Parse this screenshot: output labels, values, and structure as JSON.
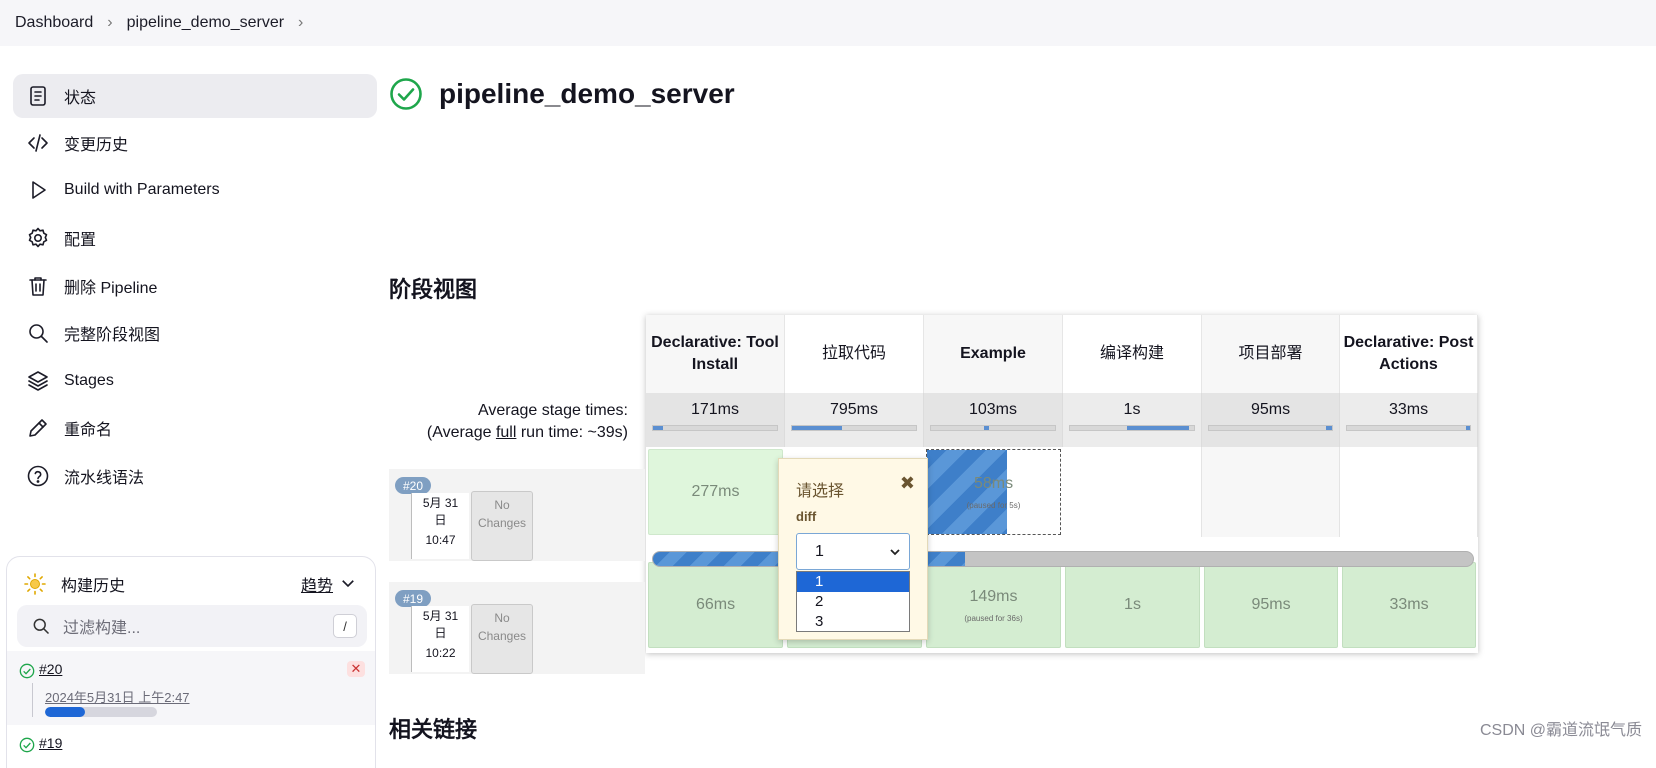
{
  "breadcrumb": {
    "items": [
      "Dashboard",
      "pipeline_demo_server"
    ],
    "separator": ">"
  },
  "sidebar": {
    "items": [
      {
        "label": "状态",
        "icon": "document-icon",
        "active": true
      },
      {
        "label": "变更历史",
        "icon": "code-icon"
      },
      {
        "label": "Build with Parameters",
        "icon": "play-icon"
      },
      {
        "label": "配置",
        "icon": "gear-icon"
      },
      {
        "label": "删除 Pipeline",
        "icon": "trash-icon"
      },
      {
        "label": "完整阶段视图",
        "icon": "search-icon"
      },
      {
        "label": "Stages",
        "icon": "layers-icon"
      },
      {
        "label": "重命名",
        "icon": "pencil-icon"
      },
      {
        "label": "流水线语法",
        "icon": "help-icon"
      }
    ]
  },
  "build_history": {
    "title": "构建历史",
    "trend_label": "趋势",
    "filter_placeholder": "过滤构建...",
    "filter_shortcut": "/",
    "builds": [
      {
        "number": "#20",
        "date": "2024年5月31日 上午2:47",
        "progress": 0.36,
        "status": "success"
      },
      {
        "number": "#19",
        "status": "success"
      }
    ]
  },
  "main": {
    "title": "pipeline_demo_server",
    "stage_view_title": "阶段视图",
    "related_links_title": "相关链接"
  },
  "stage_view": {
    "stages": [
      "Declarative: Tool Install",
      "拉取代码",
      "Example",
      "编译构建",
      "项目部署",
      "Declarative: Post Actions"
    ],
    "avg_times": [
      "171ms",
      "795ms",
      "103ms",
      "1s",
      "95ms",
      "33ms"
    ],
    "avg_label_line1": "Average stage times:",
    "avg_label_prefix": "(Average ",
    "avg_label_link": "full",
    "avg_label_suffix": " run time: ~39s)",
    "runs": [
      {
        "badge": "#20",
        "month_day": "5月 31",
        "day_unit": "日",
        "time": "10:47",
        "changes": "No Changes",
        "cells": [
          {
            "text": "277ms"
          },
          {
            "text": ""
          },
          {
            "text": "58ms",
            "note": "(paused for 5s)"
          },
          {
            "text": ""
          },
          {
            "text": ""
          },
          {
            "text": ""
          }
        ],
        "run_progress": 0.38
      },
      {
        "badge": "#19",
        "month_day": "5月 31",
        "day_unit": "日",
        "time": "10:22",
        "changes": "No Changes",
        "cells": [
          {
            "text": "66ms"
          },
          {
            "text": ""
          },
          {
            "text": "149ms",
            "note": "(paused for 36s)"
          },
          {
            "text": "1s"
          },
          {
            "text": "95ms"
          },
          {
            "text": "33ms"
          }
        ]
      }
    ]
  },
  "input_popup": {
    "title": "请选择",
    "close": "✖",
    "param_name": "diff",
    "selected": "1",
    "options": [
      "1",
      "2",
      "3"
    ]
  },
  "watermark": "CSDN @霸道流氓气质",
  "colors": {
    "accent": "#1e67d6",
    "success": "#1ea64b",
    "stage_green": "#dff6dc"
  }
}
